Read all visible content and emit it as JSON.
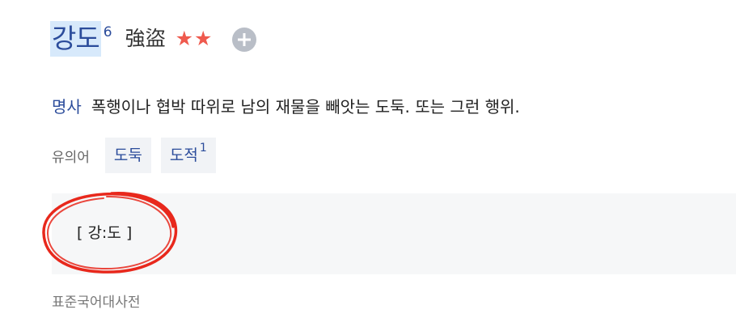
{
  "entry": {
    "headword": "강도",
    "homonym_number": "6",
    "hanja": "強盜",
    "importance_stars": "★★",
    "star_count": 2,
    "add_icon": "plus-circle-icon",
    "part_of_speech": "명사",
    "definition": "폭행이나 협박 따위로 남의 재물을 빼앗는 도둑. 또는 그런 행위.",
    "synonym_label": "유의어",
    "synonyms": [
      {
        "word": "도둑",
        "sup": ""
      },
      {
        "word": "도적",
        "sup": "1"
      }
    ],
    "pronunciation": "[ 강:도 ]",
    "source": "표준국어대사전"
  },
  "colors": {
    "link_blue": "#2b4c9b",
    "highlight": "#d7e9fb",
    "star_red": "#ef5a4e",
    "annotation_red": "#e8281c"
  }
}
